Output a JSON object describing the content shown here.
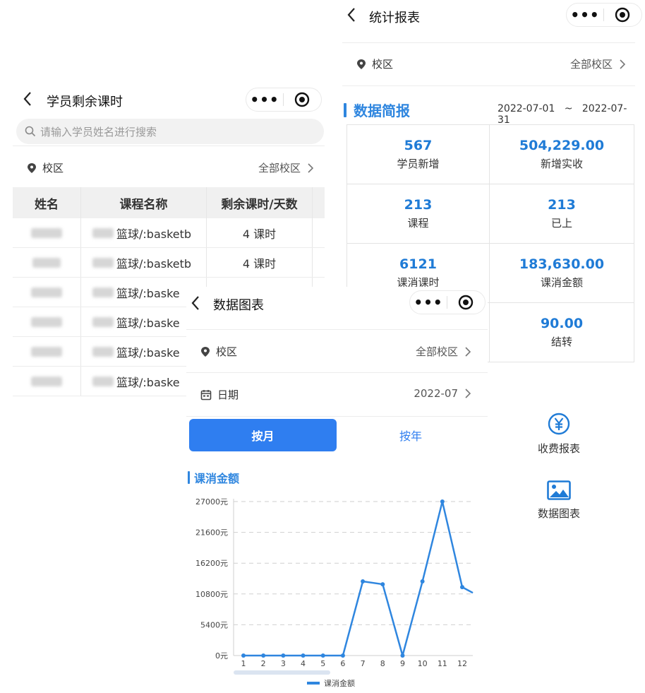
{
  "panel_a": {
    "title": "学员剩余课时",
    "search_placeholder": "请输入学员姓名进行搜索",
    "campus_label": "校区",
    "campus_value": "全部校区",
    "columns": [
      "姓名",
      "课程名称",
      "剩余课时/天数"
    ],
    "rows": [
      {
        "course": "篮球/:basketb",
        "remaining": "4 课时"
      },
      {
        "course": "篮球/:basketb",
        "remaining": "4 课时"
      },
      {
        "course": "篮球/:baske"
      },
      {
        "course": "篮球/:baske"
      },
      {
        "course": "篮球/:baske"
      },
      {
        "course": "篮球/:baske"
      }
    ]
  },
  "panel_b": {
    "title": "统计报表",
    "campus_label": "校区",
    "campus_value": "全部校区",
    "section_title": "数据简报",
    "date_start": "2022-07-01",
    "date_sep": "~",
    "date_end": "2022-07-31",
    "stats": [
      {
        "value": "567",
        "label": "学员新增"
      },
      {
        "value": "504,229.00",
        "label": "新增实收"
      },
      {
        "value": "213",
        "label": "课程"
      },
      {
        "value": "213",
        "label": "已上"
      },
      {
        "value": "6121",
        "label": "课消课时"
      },
      {
        "value": "183,630.00",
        "label": "课消金额"
      },
      {
        "value": "",
        "label": ""
      },
      {
        "value": "90.00",
        "label": "结转"
      }
    ],
    "shortcuts": [
      {
        "label": "收费报表",
        "icon": "yuan-circle-icon"
      },
      {
        "label": "数据图表",
        "icon": "image-icon"
      }
    ]
  },
  "panel_c": {
    "title": "数据图表",
    "campus_label": "校区",
    "campus_value": "全部校区",
    "date_label": "日期",
    "date_value": "2022-07",
    "tab_month": "按月",
    "tab_year": "按年",
    "chart_title": "课消金额"
  },
  "colors": {
    "accent": "#2f7ef0",
    "line": "#2f86df",
    "value_blue": "#1f7bd6"
  },
  "chart_data": {
    "type": "line",
    "title": "课消金额",
    "x": [
      "1",
      "2",
      "3",
      "4",
      "5",
      "6",
      "7",
      "8",
      "9",
      "10",
      "11",
      "12"
    ],
    "series": [
      {
        "name": "课消金额",
        "values": [
          0,
          0,
          0,
          0,
          0,
          0,
          13000,
          12500,
          0,
          13000,
          27000,
          12000
        ]
      }
    ],
    "y_ticks": [
      "0元",
      "5400元",
      "10800元",
      "16200元",
      "21600元",
      "27000元"
    ],
    "ylim": [
      0,
      27000
    ],
    "grid": "dashed horizontal",
    "legend": "bottom",
    "note_last_point": 11000
  }
}
